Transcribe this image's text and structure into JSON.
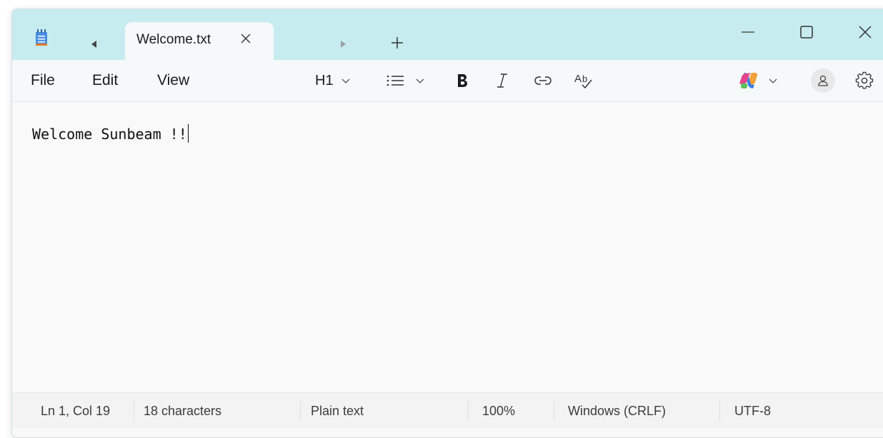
{
  "tab": {
    "title": "Welcome.txt"
  },
  "menu": {
    "file": "File",
    "edit": "Edit",
    "view": "View"
  },
  "toolbar": {
    "heading": "H1"
  },
  "editor": {
    "content": "Welcome Sunbeam !!"
  },
  "status": {
    "position": "Ln 1, Col 19",
    "characters": "18 characters",
    "format": "Plain text",
    "zoom": "100%",
    "line_ending": "Windows (CRLF)",
    "encoding": "UTF-8"
  },
  "icons": {
    "app": "notepad-icon",
    "tab_scroll_left": "triangle-left-icon",
    "tab_close": "close-icon",
    "tab_scroll_right": "triangle-right-icon",
    "new_tab": "plus-icon",
    "minimize": "minimize-icon",
    "maximize": "maximize-icon",
    "close": "close-icon",
    "heading_dropdown": "chevron-down-icon",
    "list": "list-icon",
    "bold": "bold-icon",
    "italic": "italic-icon",
    "link": "link-icon",
    "spellcheck": "spellcheck-icon",
    "copilot": "copilot-icon",
    "account": "person-icon",
    "settings": "gear-icon"
  },
  "colors": {
    "titlebar": "#c7ecf0",
    "menubar": "#f5f9fa",
    "editor": "#f9f9f9",
    "statusbar": "#f3f3f3"
  }
}
